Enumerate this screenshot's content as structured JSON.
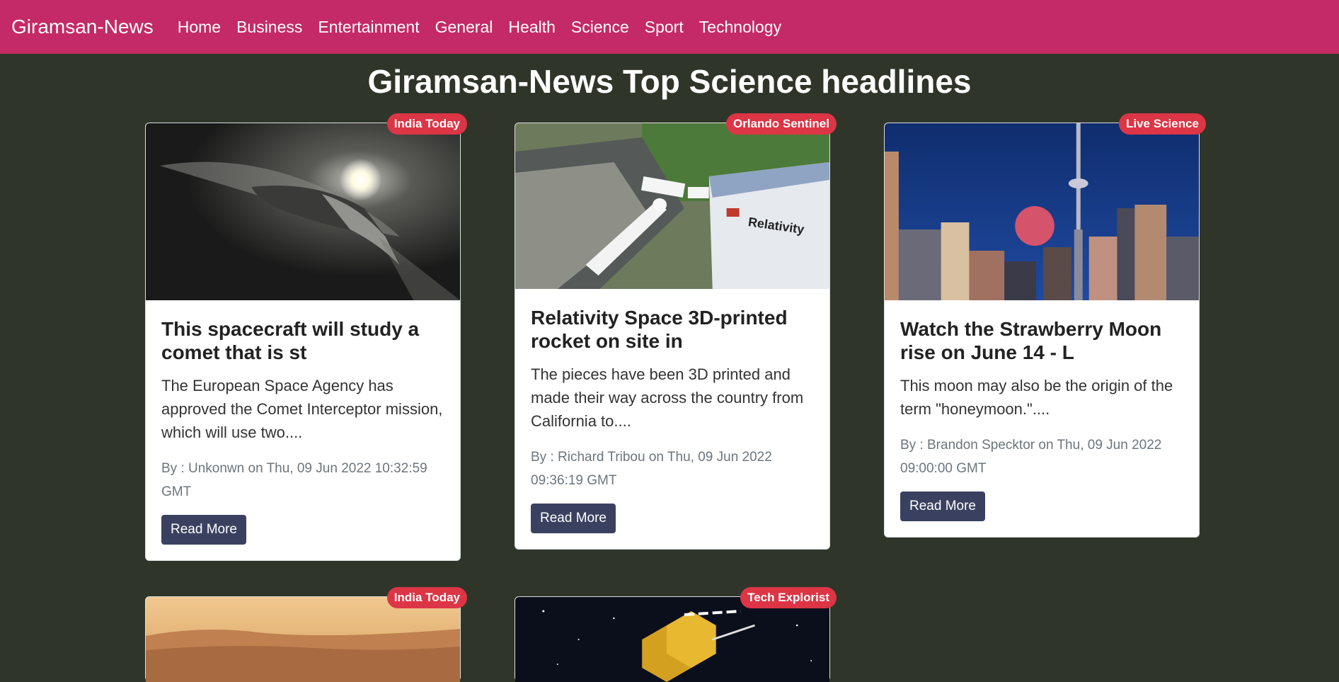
{
  "nav": {
    "brand": "Giramsan-News",
    "links": [
      "Home",
      "Business",
      "Entertainment",
      "General",
      "Health",
      "Science",
      "Sport",
      "Technology"
    ]
  },
  "page_title": "Giramsan-News Top Science headlines",
  "cards": [
    {
      "source": "India Today",
      "title": "This spacecraft will study a comet that is st",
      "description": "The European Space Agency has approved the Comet Interceptor mission, which will use two....",
      "meta": "By : Unkonwn on Thu, 09 Jun 2022 10:32:59 GMT",
      "button": "Read More",
      "image": "comet-image"
    },
    {
      "source": "Orlando Sentinel",
      "title": "Relativity Space 3D-printed rocket on site in",
      "description": "The pieces have been 3D printed and made their way across the country from California to....",
      "meta": "By : Richard Tribou on Thu, 09 Jun 2022 09:36:19 GMT",
      "button": "Read More",
      "image": "rocket-hangar-image",
      "image_text": "Relativity"
    },
    {
      "source": "Live Science",
      "title": "Watch the Strawberry Moon rise on June 14 - L",
      "description": "This moon may also be the origin of the term \"honeymoon.\"....",
      "meta": "By : Brandon Specktor on Thu, 09 Jun 2022 09:00:00 GMT",
      "button": "Read More",
      "image": "city-moon-image"
    },
    {
      "source": "India Today",
      "image": "mars-landscape-image"
    },
    {
      "source": "Tech Explorist",
      "image": "telescope-image"
    }
  ],
  "colors": {
    "navbar": "#c42a66",
    "background": "#2f3629",
    "badge": "#dc3545",
    "button": "#3a4160"
  }
}
